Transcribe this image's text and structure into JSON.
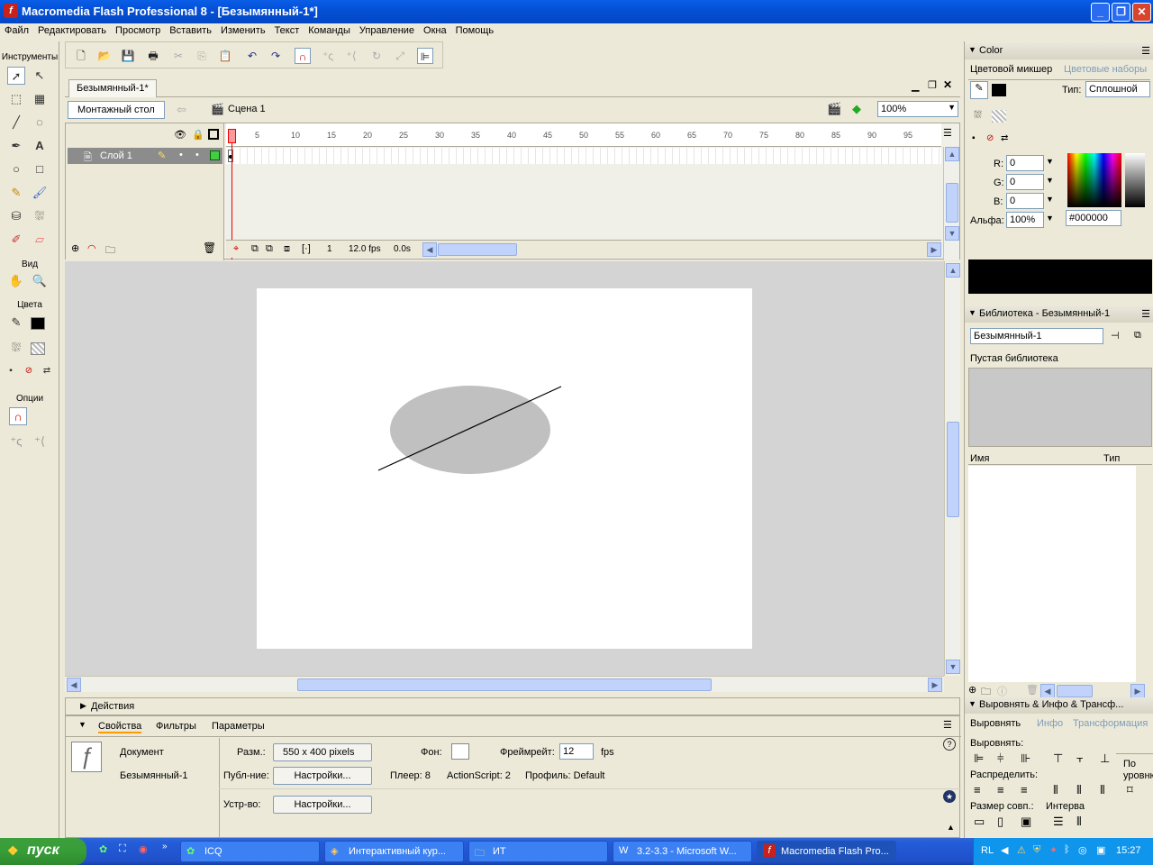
{
  "window": {
    "title": "Macromedia Flash Professional 8 - [Безымянный-1*]"
  },
  "menu": [
    "Файл",
    "Редактировать",
    "Просмотр",
    "Вставить",
    "Изменить",
    "Текст",
    "Команды",
    "Управление",
    "Окна",
    "Помощь"
  ],
  "tools": {
    "header": "Инструменты",
    "view_label": "Вид",
    "colors_label": "Цвета",
    "options_label": "Опции"
  },
  "document": {
    "tab": "Безымянный-1*",
    "timeline_button": "Монтажный стол",
    "scene": "Сцена 1",
    "zoom": "100%"
  },
  "timeline": {
    "frame_numbers": [
      "5",
      "10",
      "15",
      "20",
      "25",
      "30",
      "35",
      "40",
      "45",
      "50",
      "55",
      "60",
      "65",
      "70",
      "75",
      "80",
      "85",
      "90",
      "95"
    ],
    "layer_name": "Слой 1",
    "current_frame": "1",
    "fps": "12.0 fps",
    "time": "0.0s"
  },
  "panels": {
    "actions": "Действия",
    "props_tabs": [
      "Свойства",
      "Фильтры",
      "Параметры"
    ]
  },
  "properties": {
    "doc_type": "Документ",
    "doc_name": "Безымянный-1",
    "size_label": "Разм.:",
    "size_value": "550 x 400 pixels",
    "bg_label": "Фон:",
    "framerate_label": "Фреймрейт:",
    "framerate_value": "12",
    "fps_unit": "fps",
    "publish_label": "Публ-ние:",
    "publish_btn": "Настройки...",
    "player": "Плеер: 8",
    "actionscript": "ActionScript:  2",
    "profile": "Профиль: Default",
    "device_label": "Устр-во:",
    "device_btn": "Настройки..."
  },
  "color_panel": {
    "title": "Color",
    "tab_active": "Цветовой микшер",
    "tab_inactive": "Цветовые наборы",
    "type_label": "Тип:",
    "type_value": "Сплошной",
    "r_label": "R:",
    "r_value": "0",
    "g_label": "G:",
    "g_value": "0",
    "b_label": "B:",
    "b_value": "0",
    "alpha_label": "Альфа:",
    "alpha_value": "100%",
    "hex": "#000000"
  },
  "library_panel": {
    "title": "Библиотека - Безымянный-1",
    "selector": "Безымянный-1",
    "status": "Пустая библиотека",
    "col_name": "Имя",
    "col_type": "Тип"
  },
  "align_panel": {
    "title": "Выровнять & Инфо & Трансф...",
    "tabs": [
      "Выровнять",
      "Инфо",
      "Трансформация"
    ],
    "align_label": "Выровнять:",
    "distribute_label": "Распределить:",
    "match_label": "Размер совп.:",
    "space_label": "Интерва",
    "to_stage": "По уровню"
  },
  "taskbar": {
    "start": "пуск",
    "tasks": [
      "ICQ",
      "Интерактивный кур...",
      "ИТ",
      "3.2-3.3 - Microsoft W...",
      "Macromedia Flash Pro..."
    ],
    "lang": "RL",
    "clock": "15:27"
  },
  "colors": {
    "accent": "#0a5ee8",
    "stage_bg": "#ffffff",
    "ellipse_fill": "#c0c0c0",
    "stroke": "#000000"
  }
}
